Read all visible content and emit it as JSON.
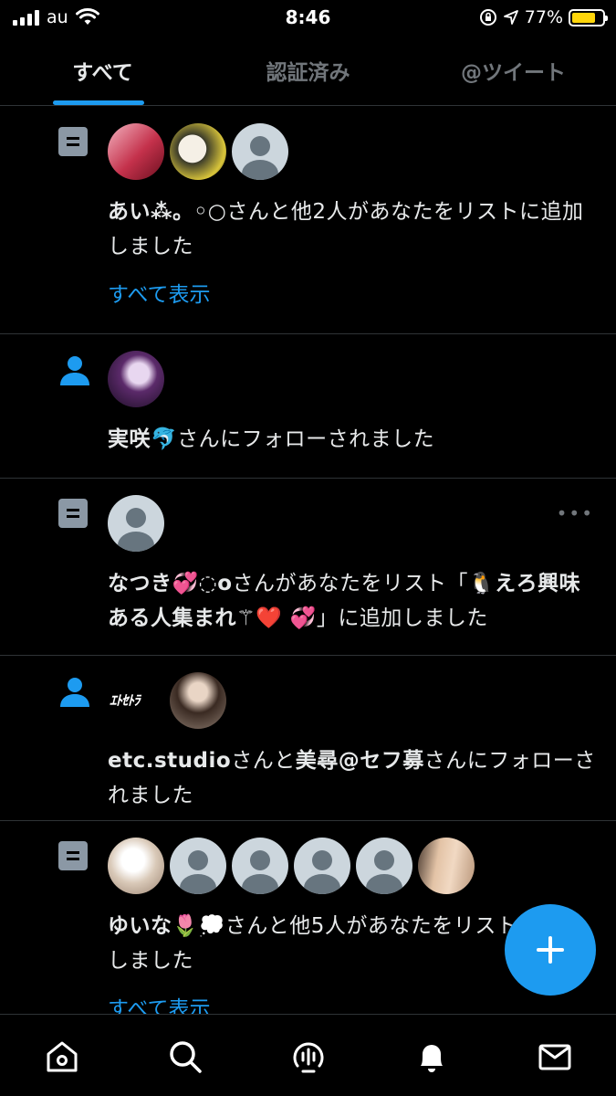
{
  "statusbar": {
    "carrier": "au",
    "time": "8:46",
    "battery_pct": "77%",
    "battery_level": 0.77,
    "battery_color": "#ffd60a"
  },
  "tabs": [
    {
      "label": "すべて",
      "active": true
    },
    {
      "label": "認証済み",
      "active": false
    },
    {
      "label": "@ツイート",
      "active": false
    }
  ],
  "accent_color": "#1d9bf0",
  "notifications": [
    {
      "type": "list-add",
      "name": "あい⁂。◦○",
      "text": "さんと他2人があなたをリストに追加しました",
      "link": "すべて表示"
    },
    {
      "type": "follow",
      "name": "実咲🐬",
      "text": "さんにフォローされました"
    },
    {
      "type": "list-add",
      "name": "なつき💞◌o",
      "text": "さんがあなたをリスト「🐧",
      "bold2": "えろ興味ある人集まれ⚚❤️ 💞",
      "text2": "」に追加しました"
    },
    {
      "type": "follow",
      "logo_text": "ｴﾄｾﾄﾗ",
      "name": "etc.studio",
      "text": "さんと",
      "name2": "美尋@セフ募",
      "text2": "さんにフォローされました"
    },
    {
      "type": "list-add",
      "name": "ゆいな🌷💭",
      "text": "さんと他5人があなたをリストに追加しました",
      "link": "すべて表示"
    }
  ],
  "icons": {
    "home": "home-icon",
    "search": "search-icon",
    "spaces": "spaces-icon",
    "notifications": "bell-icon",
    "messages": "envelope-icon",
    "compose": "plus-icon"
  }
}
